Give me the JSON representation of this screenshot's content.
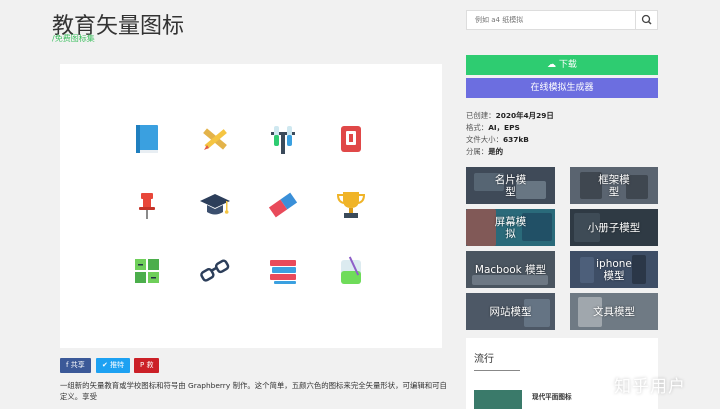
{
  "header": {
    "title": "教育矢量图标",
    "breadcrumb": "/免费图标集"
  },
  "share": {
    "facebook": "f 共享",
    "twitter": "推特",
    "pinterest": "P 救"
  },
  "description": "一组新的矢量教育或学校图标和符号由 Graphberry 制作。这个简单，五颜六色的图标来完全矢量形状，可编辑和可自定义。享受",
  "search": {
    "placeholder": "例如 a4 纸模拟"
  },
  "buttons": {
    "download": "下载",
    "generator": "在线模拟生成器"
  },
  "meta": {
    "created_label": "已创建：",
    "created_value": "2020年4月29日",
    "format_label": "格式：",
    "format_value": "AI，EPS",
    "size_label": "文件大小：",
    "size_value": "637kB",
    "attribution_label": "分属：",
    "attribution_value": "是的"
  },
  "tiles": [
    {
      "label": "名片模型"
    },
    {
      "label": "框架模型"
    },
    {
      "label": "屏幕模拟"
    },
    {
      "label": "小册子模型"
    },
    {
      "label": "Macbook 模型"
    },
    {
      "label": "iphone 模型"
    },
    {
      "label": "网站模型"
    },
    {
      "label": "文具模型"
    }
  ],
  "popular": {
    "title": "流行",
    "item": "现代平面图标"
  },
  "watermark": "知乎用户",
  "colors": {
    "green": "#2ecc71",
    "purple": "#6c6ee0",
    "accent": "#3cbf5f"
  }
}
